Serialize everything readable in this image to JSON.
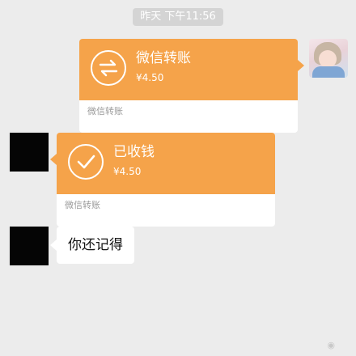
{
  "timestamp": "昨天 下午11:56",
  "messages": [
    {
      "type": "transfer",
      "side": "right",
      "title": "微信转账",
      "amount": "¥4.50",
      "footer": "微信转账",
      "icon": "transfer-arrows-icon"
    },
    {
      "type": "transfer",
      "side": "left",
      "title": "已收钱",
      "amount": "¥4.50",
      "footer": "微信转账",
      "icon": "checkmark-icon"
    },
    {
      "type": "text",
      "side": "left",
      "text": "你还记得"
    }
  ],
  "colors": {
    "transfer_orange": "#f5a34a",
    "chat_background": "#ececec",
    "timestamp_pill": "#d4d4d4"
  }
}
